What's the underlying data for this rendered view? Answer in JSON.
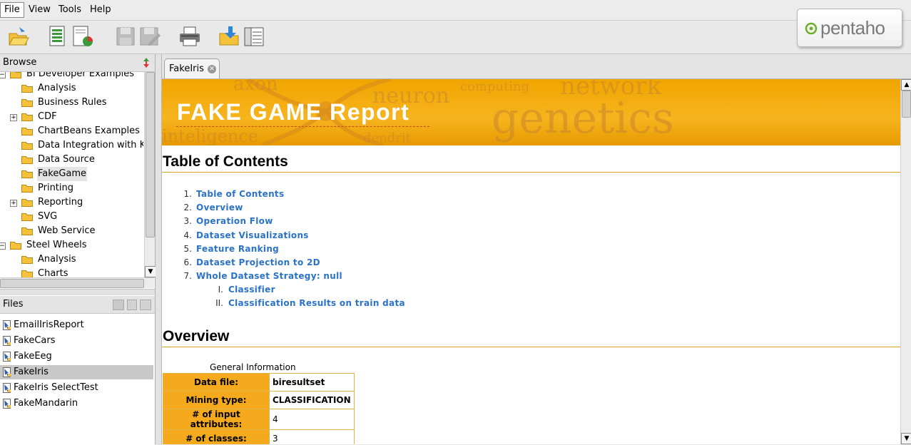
{
  "menu": {
    "items": [
      "File",
      "View",
      "Tools",
      "Help"
    ]
  },
  "toolbar": {
    "buttons": [
      {
        "name": "open-icon"
      },
      {
        "name": "new-report-icon"
      },
      {
        "name": "new-chart-icon"
      },
      {
        "name": "save-icon"
      },
      {
        "name": "save-as-icon"
      },
      {
        "name": "print-icon"
      },
      {
        "name": "publish-icon"
      },
      {
        "name": "properties-icon"
      }
    ]
  },
  "logo": {
    "text": "pentaho",
    "dot": "™"
  },
  "browse": {
    "title": "Browse",
    "tree": [
      {
        "label": "BI Developer Examples",
        "level": 0,
        "expander": "minus"
      },
      {
        "label": "Analysis",
        "level": 1
      },
      {
        "label": "Business Rules",
        "level": 1
      },
      {
        "label": "CDF",
        "level": 1,
        "expander": "plus"
      },
      {
        "label": "ChartBeans Examples",
        "level": 1
      },
      {
        "label": "Data Integration with Kettl",
        "level": 1
      },
      {
        "label": "Data Source",
        "level": 1
      },
      {
        "label": "FakeGame",
        "level": 1,
        "selected": true
      },
      {
        "label": "Printing",
        "level": 1
      },
      {
        "label": "Reporting",
        "level": 1,
        "expander": "plus"
      },
      {
        "label": "SVG",
        "level": 1
      },
      {
        "label": "Web Service",
        "level": 1
      },
      {
        "label": "Steel Wheels",
        "level": 0,
        "expander": "minus"
      },
      {
        "label": "Analysis",
        "level": 1
      },
      {
        "label": "Charts",
        "level": 1
      }
    ]
  },
  "files": {
    "title": "Files",
    "items": [
      {
        "label": "EmailIrisReport"
      },
      {
        "label": "FakeCars"
      },
      {
        "label": "FakeEeg"
      },
      {
        "label": "FakeIris",
        "selected": true
      },
      {
        "label": "FakeIris SelectTest"
      },
      {
        "label": "FakeMandarin"
      }
    ]
  },
  "tab": {
    "label": "FakeIris"
  },
  "report": {
    "banner_title": "FAKE GAME Report",
    "banner_words": [
      "axon",
      "neuron",
      "computing",
      "network",
      "genetics",
      "inteligence",
      "dendrit"
    ],
    "toc_heading": "Table of Contents",
    "toc": [
      {
        "num": "1.",
        "label": "Table of Contents"
      },
      {
        "num": "2.",
        "label": "Overview"
      },
      {
        "num": "3.",
        "label": "Operation Flow"
      },
      {
        "num": "4.",
        "label": "Dataset Visualizations"
      },
      {
        "num": "5.",
        "label": "Feature Ranking"
      },
      {
        "num": "6.",
        "label": "Dataset Projection to 2D"
      },
      {
        "num": "7.",
        "label": "Whole Dataset Strategy: null"
      }
    ],
    "toc_sub": [
      {
        "num": "I.",
        "label": "Classifier"
      },
      {
        "num": "II.",
        "label": "Classification Results on train data"
      }
    ],
    "overview_heading": "Overview",
    "general_caption": "General Information",
    "general": [
      {
        "key": "Data file:",
        "value": "biresultset",
        "bold": true
      },
      {
        "key": "Mining type:",
        "value": "CLASSIFICATION",
        "bold": true
      },
      {
        "key": "# of input attributes:",
        "value": "4",
        "bold": false
      },
      {
        "key": "# of classes:",
        "value": "3",
        "bold": false
      }
    ]
  },
  "colors": {
    "banner": "#f4aa1c",
    "link": "#2b73c8",
    "rule": "#d9a21f"
  }
}
